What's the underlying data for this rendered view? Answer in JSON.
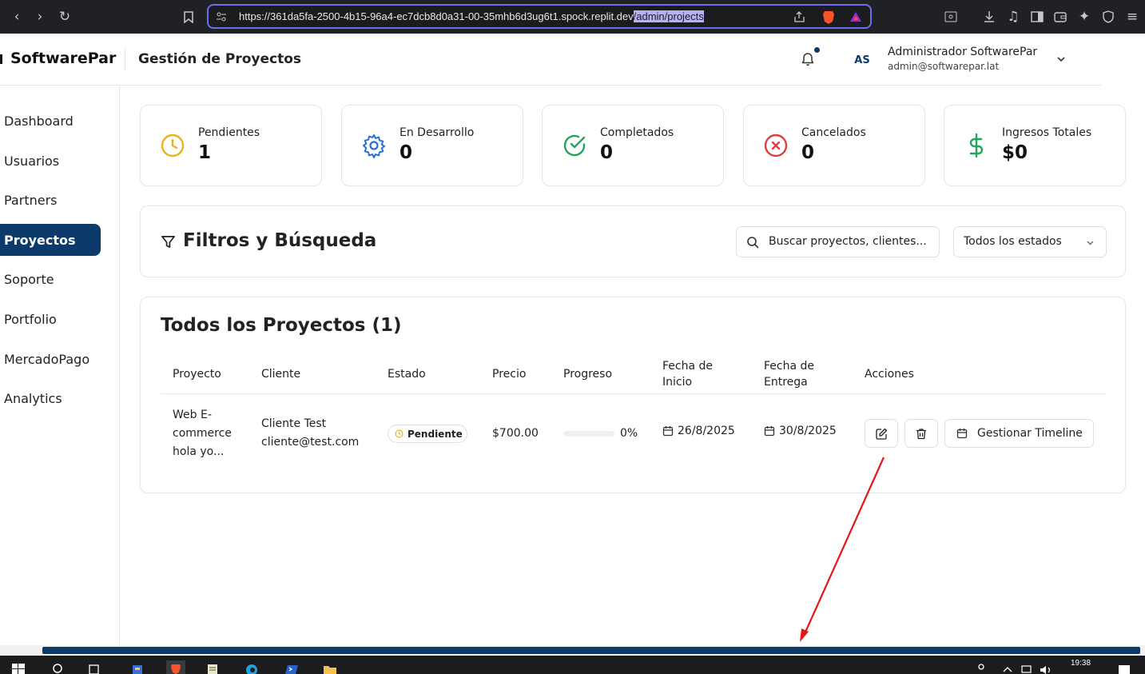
{
  "browser": {
    "url_prefix": "https://361da5fa-2500-4b15-96a4-ec7dcb8d0a31-00-35mhb6d3ug6t1.spock.replit.dev",
    "url_selected": "/admin/projects"
  },
  "header": {
    "brand": "SoftwarePar",
    "title": "Gestión de Proyectos",
    "avatar_initials": "AS",
    "user_name": "Administrador SoftwarePar",
    "user_email": "admin@softwarepar.lat"
  },
  "sidebar": {
    "items": [
      {
        "label": "Dashboard",
        "active": false
      },
      {
        "label": "Usuarios",
        "active": false
      },
      {
        "label": "Partners",
        "active": false
      },
      {
        "label": "Proyectos",
        "active": true
      },
      {
        "label": "Soporte",
        "active": false
      },
      {
        "label": "Portfolio",
        "active": false
      },
      {
        "label": "MercadoPago",
        "active": false
      },
      {
        "label": "Analytics",
        "active": false
      }
    ]
  },
  "stats": [
    {
      "label": "Pendientes",
      "value": "1",
      "icon": "clock-icon",
      "color": "#e8b21a"
    },
    {
      "label": "En Desarrollo",
      "value": "0",
      "icon": "gear-icon",
      "color": "#2b6fd6"
    },
    {
      "label": "Completados",
      "value": "0",
      "icon": "check-circle-icon",
      "color": "#22a55a"
    },
    {
      "label": "Cancelados",
      "value": "0",
      "icon": "x-circle-icon",
      "color": "#e03e3e"
    },
    {
      "label": "Ingresos Totales",
      "value": "$0",
      "icon": "dollar-icon",
      "color": "#22a55a"
    }
  ],
  "filters": {
    "title": "Filtros y Búsqueda",
    "search_placeholder": "Buscar proyectos, clientes...",
    "status_select": "Todos los estados"
  },
  "projects": {
    "title": "Todos los Proyectos (1)",
    "columns": [
      "Proyecto",
      "Cliente",
      "Estado",
      "Precio",
      "Progreso",
      "Fecha de Inicio",
      "Fecha de Entrega",
      "Acciones"
    ],
    "rows": [
      {
        "project": "Web E-commerce hola yo...",
        "client_name": "Cliente Test",
        "client_email": "cliente@test.com",
        "status": "Pendiente",
        "price": "$700.00",
        "progress_text": "0%",
        "progress": 0,
        "start_date": "26/8/2025",
        "end_date": "30/8/2025",
        "timeline_button": "Gestionar Timeline"
      }
    ]
  },
  "taskbar": {
    "time": "19:38"
  }
}
